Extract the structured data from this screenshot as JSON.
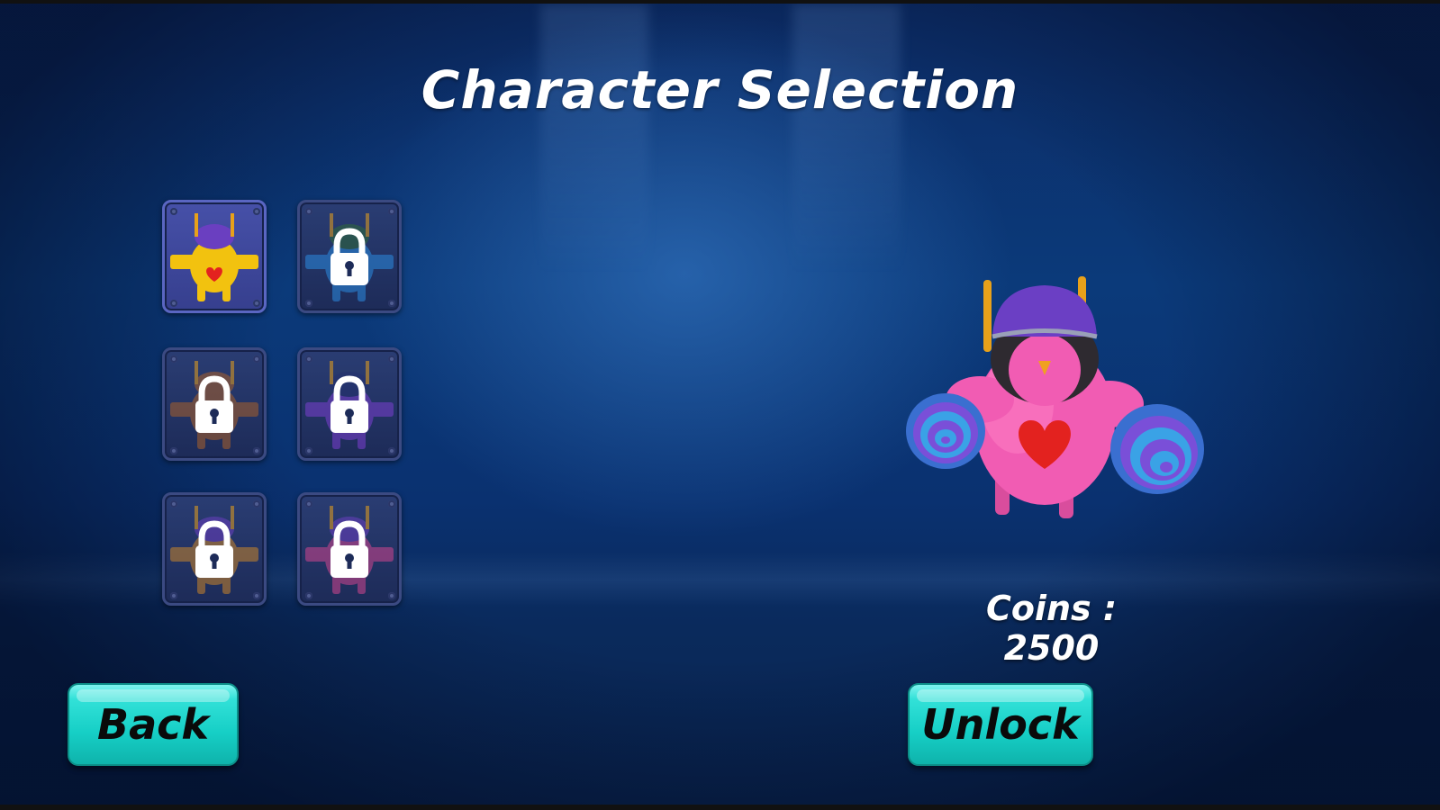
{
  "screen": {
    "title": "Character Selection",
    "coins_text": "Coins : 2500"
  },
  "buttons": {
    "back_label": "Back",
    "unlock_label": "Unlock"
  },
  "characters": [
    {
      "color": "#f2c20f",
      "hat": "#6a3fc0",
      "locked": false,
      "selected": true
    },
    {
      "color": "#2b8be0",
      "hat": "#2f6a3a",
      "locked": true,
      "selected": false
    },
    {
      "color": "#a8602a",
      "hat": "#a8602a",
      "locked": true,
      "selected": false
    },
    {
      "color": "#7b3fd0",
      "hat": "#243070",
      "locked": true,
      "selected": false
    },
    {
      "color": "#c8842a",
      "hat": "#6a3fc0",
      "locked": true,
      "selected": false
    },
    {
      "color": "#d0458f",
      "hat": "#6a3fc0",
      "locked": true,
      "selected": false
    }
  ],
  "colors": {
    "accent": "#1fd6cc",
    "preview_body": "#f15cb3",
    "preview_hat": "#6b3fc4",
    "heart": "#e3221f"
  },
  "icons": [
    "lock-icon",
    "heart-icon"
  ]
}
